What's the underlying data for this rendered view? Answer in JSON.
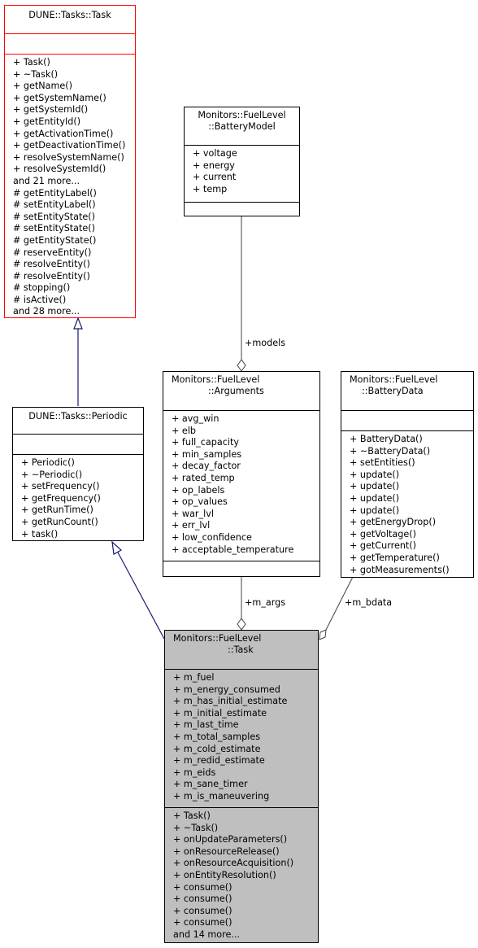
{
  "colors": {
    "base_border": "#ff0000",
    "inheritance_edge": "#191970",
    "association_edge": "#404040",
    "focus_fill": "#bfbfbf"
  },
  "classes": {
    "task_base": {
      "title_lines": [
        "DUNE::Tasks::Task"
      ],
      "attributes": [],
      "methods": [
        "+ Task()",
        "+ ~Task()",
        "+ getName()",
        "+ getSystemName()",
        "+ getSystemId()",
        "+ getEntityId()",
        "+ getActivationTime()",
        "+ getDeactivationTime()",
        "+ resolveSystemName()",
        "+ resolveSystemId()",
        "and 21 more...",
        "# getEntityLabel()",
        "# setEntityLabel()",
        "# setEntityState()",
        "# setEntityState()",
        "# getEntityState()",
        "# reserveEntity()",
        "# resolveEntity()",
        "# resolveEntity()",
        "# stopping()",
        "# isActive()",
        "and 28 more..."
      ]
    },
    "periodic": {
      "title_lines": [
        "DUNE::Tasks::Periodic"
      ],
      "attributes": [],
      "methods": [
        "+ Periodic()",
        "+ ~Periodic()",
        "+ setFrequency()",
        "+ getFrequency()",
        "+ getRunTime()",
        "+ getRunCount()",
        "+ task()"
      ]
    },
    "battery_model": {
      "title_lines": [
        "Monitors::FuelLevel",
        "::BatteryModel"
      ],
      "attributes": [
        "+ voltage",
        "+ energy",
        "+ current",
        "+ temp"
      ],
      "methods": []
    },
    "arguments": {
      "title_lines": [
        "Monitors::FuelLevel",
        "::Arguments"
      ],
      "attributes": [
        "+ avg_win",
        "+ elb",
        "+ full_capacity",
        "+ min_samples",
        "+ decay_factor",
        "+ rated_temp",
        "+ op_labels",
        "+ op_values",
        "+ war_lvl",
        "+ err_lvl",
        "+ low_confidence",
        "+ acceptable_temperature"
      ],
      "methods": []
    },
    "battery_data": {
      "title_lines": [
        "Monitors::FuelLevel",
        "::BatteryData"
      ],
      "attributes": [],
      "methods": [
        "+ BatteryData()",
        "+ ~BatteryData()",
        "+ setEntities()",
        "+ update()",
        "+ update()",
        "+ update()",
        "+ update()",
        "+ getEnergyDrop()",
        "+ getVoltage()",
        "+ getCurrent()",
        "+ getTemperature()",
        "+ gotMeasurements()"
      ]
    },
    "fuel_task": {
      "title_lines": [
        "Monitors::FuelLevel",
        "::Task"
      ],
      "attributes": [
        "+ m_fuel",
        "+ m_energy_consumed",
        "+ m_has_initial_estimate",
        "+ m_initial_estimate",
        "+ m_last_time",
        "+ m_total_samples",
        "+ m_cold_estimate",
        "+ m_redid_estimate",
        "+ m_eids",
        "+ m_sane_timer",
        "+ m_is_maneuvering"
      ],
      "methods": [
        "+ Task()",
        "+ ~Task()",
        "+ onUpdateParameters()",
        "+ onResourceRelease()",
        "+ onResourceAcquisition()",
        "+ onEntityResolution()",
        "+ consume()",
        "+ consume()",
        "+ consume()",
        "+ consume()",
        "and 14 more..."
      ]
    }
  },
  "edges": [
    {
      "from": "periodic",
      "to": "task_base",
      "kind": "inheritance"
    },
    {
      "from": "fuel_task",
      "to": "periodic",
      "kind": "inheritance"
    },
    {
      "from": "battery_model",
      "to": "arguments",
      "kind": "aggregation",
      "label": "+models"
    },
    {
      "from": "arguments",
      "to": "fuel_task",
      "kind": "aggregation",
      "label": "+m_args"
    },
    {
      "from": "battery_data",
      "to": "fuel_task",
      "kind": "aggregation",
      "label": "+m_bdata"
    }
  ]
}
